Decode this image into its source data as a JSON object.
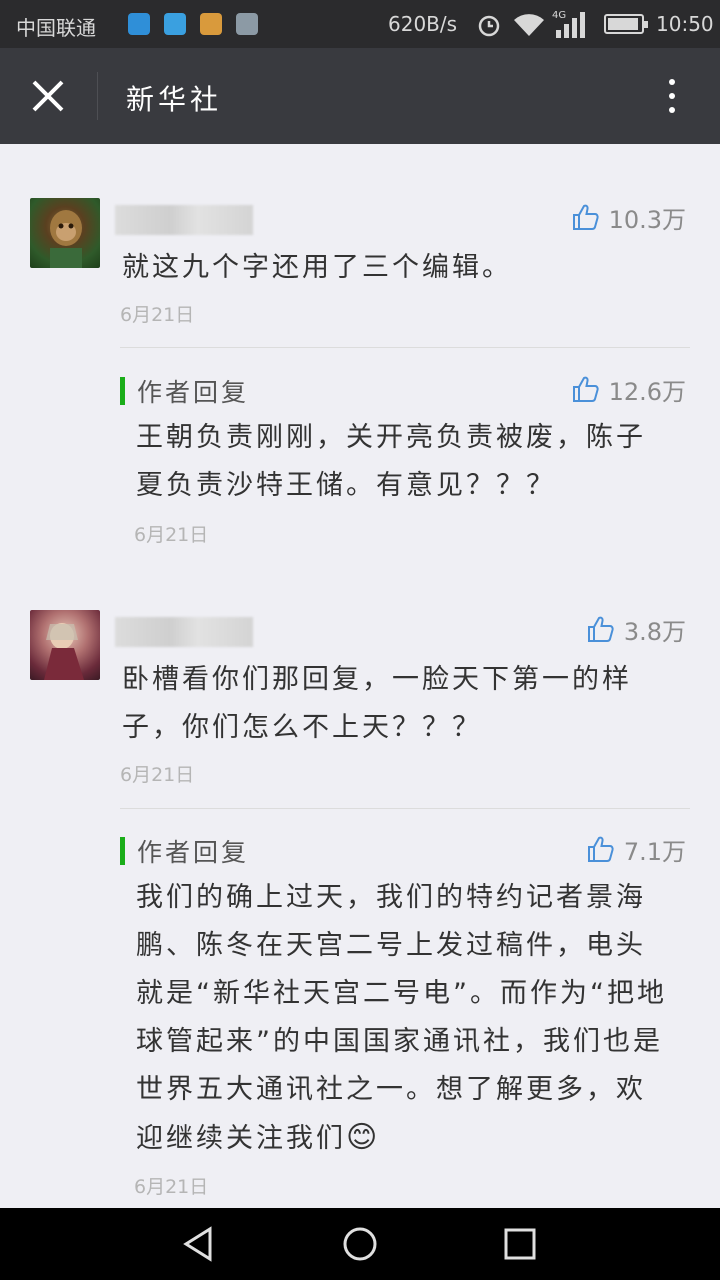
{
  "status_bar": {
    "carrier": "中国联通",
    "net_speed": "620B/s",
    "network_type": "4G",
    "time": "10:50"
  },
  "header": {
    "title": "新华社",
    "close_icon": "close-icon",
    "more_icon": "more-vertical-icon"
  },
  "comments": [
    {
      "likes": "10.3万",
      "text": "就这九个字还用了三个编辑。",
      "date": "6月21日",
      "reply": {
        "label": "作者回复",
        "likes": "12.6万",
        "text_lines": [
          "王朝负责刚刚，关开亮负责被废，陈子",
          "夏负责沙特王储。有意见？？？"
        ],
        "date": "6月21日"
      }
    },
    {
      "likes": "3.8万",
      "text_lines": [
        "卧槽看你们那回复，一脸天下第一的样",
        "子，你们怎么不上天？？？"
      ],
      "date": "6月21日",
      "reply": {
        "label": "作者回复",
        "likes": "7.1万",
        "text_lines": [
          "我们的确上过天，我们的特约记者景海",
          "鹏、陈冬在天宫二号上发过稿件，电头",
          "就是“新华社天宫二号电”。而作为“把地",
          "球管起来”的中国国家通讯社，我们也是",
          "世界五大通讯社之一。想了解更多，欢",
          "迎继续关注我们"
        ],
        "emoji": "😊",
        "date": "6月21日"
      }
    }
  ],
  "android_nav": {
    "back_icon": "back-triangle-icon",
    "home_icon": "home-circle-icon",
    "recents_icon": "recents-square-icon"
  }
}
